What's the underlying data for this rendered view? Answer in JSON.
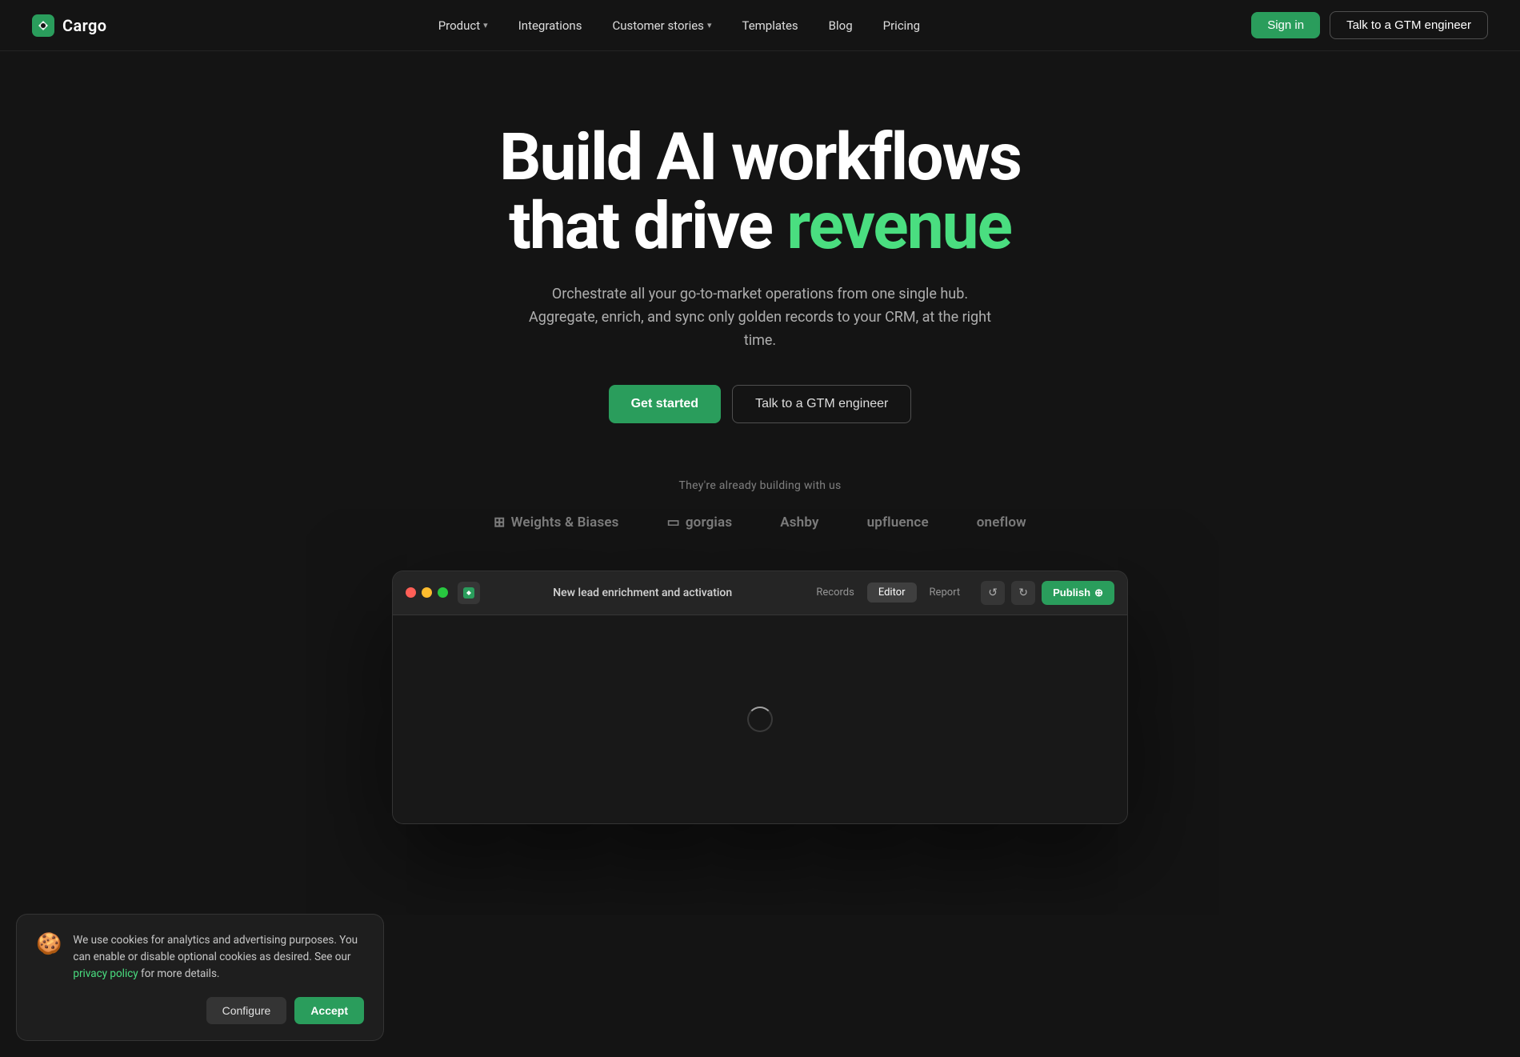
{
  "nav": {
    "logo_text": "Cargo",
    "links": [
      {
        "label": "Product",
        "has_dropdown": true
      },
      {
        "label": "Integrations",
        "has_dropdown": false
      },
      {
        "label": "Customer stories",
        "has_dropdown": true
      },
      {
        "label": "Templates",
        "has_dropdown": false
      },
      {
        "label": "Blog",
        "has_dropdown": false
      },
      {
        "label": "Pricing",
        "has_dropdown": false
      }
    ],
    "sign_in_label": "Sign in",
    "talk_label": "Talk to a GTM engineer"
  },
  "hero": {
    "title_line1": "Build AI workflows",
    "title_line2_normal": "that drive",
    "title_line2_green": "revenue",
    "subtitle_line1": "Orchestrate all your go-to-market operations from one single hub.",
    "subtitle_line2": "Aggregate, enrich, and sync only golden records to your CRM, at the right time.",
    "cta_primary": "Get started",
    "cta_secondary": "Talk to a GTM engineer"
  },
  "social_proof": {
    "text": "They're already building with us",
    "logos": [
      {
        "name": "Weights & Biases",
        "icon": "grid"
      },
      {
        "name": "gorgias",
        "icon": "square"
      },
      {
        "name": "Ashby",
        "icon": ""
      },
      {
        "name": "upfluence",
        "icon": ""
      },
      {
        "name": "oneflow",
        "icon": ""
      }
    ]
  },
  "app_window": {
    "title": "New lead enrichment and activation",
    "tabs": [
      {
        "label": "Records",
        "active": false
      },
      {
        "label": "Editor",
        "active": true
      },
      {
        "label": "Report",
        "active": false
      }
    ],
    "publish_label": "Publish",
    "loading": true
  },
  "cookie_banner": {
    "emoji": "🍪",
    "text_main": "We use cookies for analytics and advertising purposes. You can enable or disable optional cookies as desired. See our ",
    "link_text": "privacy policy",
    "text_end": " for more details.",
    "configure_label": "Configure",
    "accept_label": "Accept"
  },
  "colors": {
    "green": "#4ade80",
    "green_btn": "#2a9d5c",
    "bg": "#141414",
    "surface": "#1e1e1e"
  }
}
